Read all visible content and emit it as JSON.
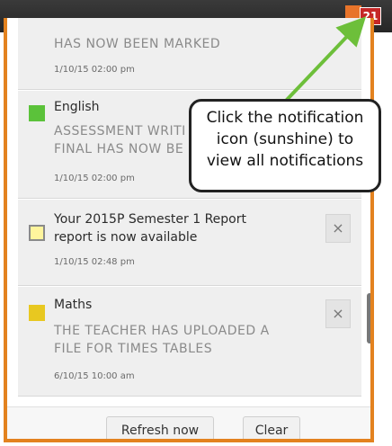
{
  "header": {
    "badge_count": "21"
  },
  "notifications": [
    {
      "title": "",
      "body": "HAS NOW BEEN MARKED",
      "date": "1/10/15 02:00 pm",
      "icon": "none"
    },
    {
      "title": "English",
      "body1": "ASSESSMENT WRITI",
      "body2": "FINAL HAS NOW BE",
      "date": "1/10/15 02:00 pm",
      "icon": "green-square-icon",
      "color": "#5bc23a"
    },
    {
      "title1": "Your 2015P Semester 1 Report",
      "title2": "report is now available",
      "date": "1/10/15 02:48 pm",
      "icon": "report-icon",
      "close": "×"
    },
    {
      "title": "Maths",
      "body1": "THE TEACHER HAS UPLOADED A",
      "body2": "FILE FOR TIMES TABLES",
      "date": "6/10/15 10:00 am",
      "icon": "yellow-square-icon",
      "color": "#e8c820",
      "close": "×"
    }
  ],
  "footer": {
    "refresh_label": "Refresh now",
    "clear_label": "Clear"
  },
  "callout": {
    "line1": "Click the notification",
    "line2": "icon (sunshine) to",
    "line3": "view all notifications"
  },
  "colors": {
    "accent": "#e3821f",
    "arrow": "#6dbf3a",
    "badge": "#c62828"
  }
}
